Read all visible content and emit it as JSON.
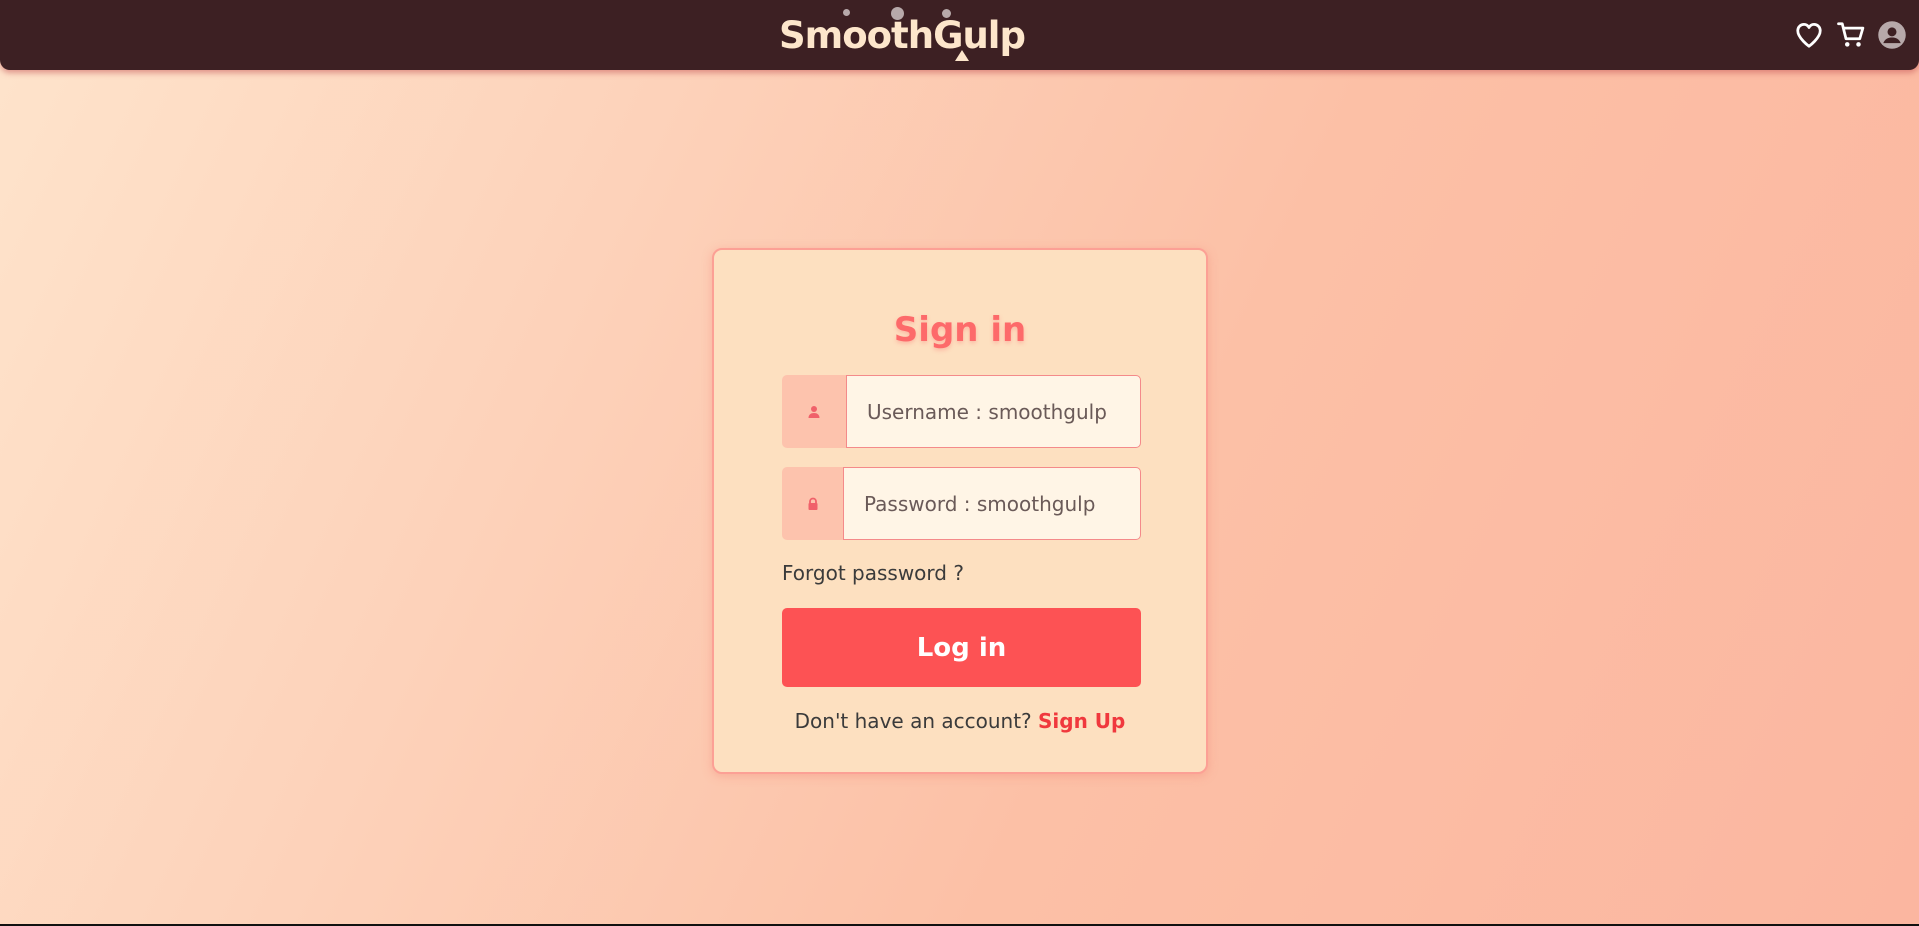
{
  "navbar": {
    "logo_text": "SmoothGulp",
    "icons": [
      "heart-icon",
      "cart-icon",
      "account-icon"
    ],
    "background": "#3d2023",
    "logo_color": "#fde6cb"
  },
  "signin": {
    "title": "Sign in",
    "username_placeholder": "Username : smoothgulp",
    "password_placeholder": "Password : smoothgulp",
    "forgot_text": "Forgot password ?",
    "login_label": "Log in",
    "no_account_text": "Don't have an account?",
    "signup_label": "Sign Up"
  },
  "colors": {
    "accent": "#fd5254",
    "title": "#fd6a6a",
    "card_bg": "#fde0c0",
    "input_bg": "#fff5e6"
  }
}
